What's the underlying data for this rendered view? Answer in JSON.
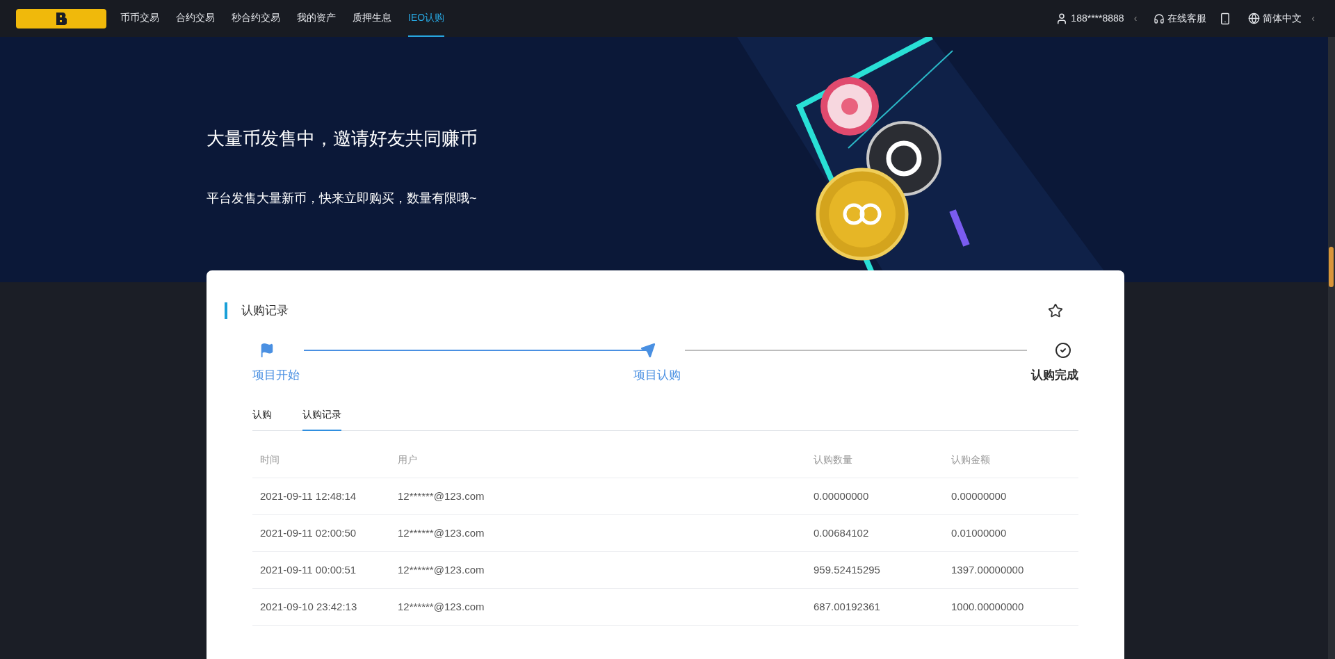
{
  "nav": {
    "items": [
      {
        "label": "币币交易",
        "selected": false
      },
      {
        "label": "合约交易",
        "selected": false
      },
      {
        "label": "秒合约交易",
        "selected": false
      },
      {
        "label": "我的资产",
        "selected": false
      },
      {
        "label": "质押生息",
        "selected": false
      },
      {
        "label": "IEO认购",
        "selected": true
      }
    ],
    "user": "188****8888",
    "user_caret": "‹",
    "support": "在线客服",
    "language": "简体中文",
    "language_caret": "‹"
  },
  "banner": {
    "title": "大量币发售中，邀请好友共同赚币",
    "subtitle": "平台发售大量新币，快来立即购买，数量有限哦~"
  },
  "card": {
    "title": "认购记录",
    "steps": [
      {
        "label": "项目开始",
        "kind": "flag",
        "done": true
      },
      {
        "label": "项目认购",
        "kind": "send",
        "done": true
      },
      {
        "label": "认购完成",
        "kind": "check",
        "done": false
      }
    ],
    "tabs": [
      {
        "label": "认购",
        "selected": false
      },
      {
        "label": "认购记录",
        "selected": true
      }
    ],
    "table": {
      "columns": [
        "时间",
        "用户",
        "认购数量",
        "认购金额"
      ],
      "rows": [
        [
          "2021-09-11 12:48:14",
          "12******@123.com",
          "0.00000000",
          "0.00000000"
        ],
        [
          "2021-09-11 02:00:50",
          "12******@123.com",
          "0.00684102",
          "0.01000000"
        ],
        [
          "2021-09-11 00:00:51",
          "12******@123.com",
          "959.52415295",
          "1397.00000000"
        ],
        [
          "2021-09-10 23:42:13",
          "12******@123.com",
          "687.00192361",
          "1000.00000000"
        ]
      ]
    }
  }
}
